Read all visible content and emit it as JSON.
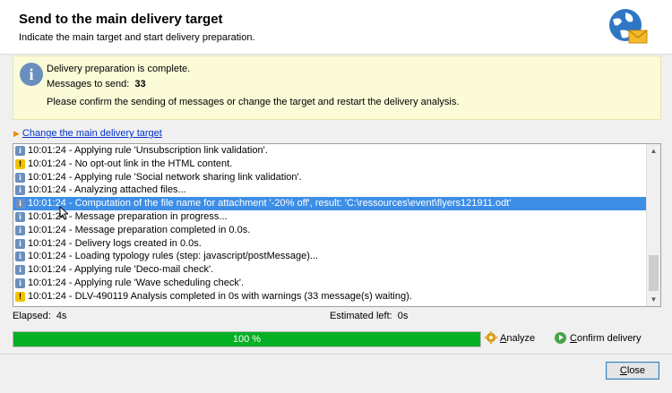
{
  "header": {
    "title": "Send to the main delivery target",
    "subtitle": "Indicate the main target and start delivery preparation."
  },
  "info": {
    "line1": "Delivery preparation is complete.",
    "messages_label": "Messages to send:",
    "messages_count": "33",
    "line3": "Please confirm the sending of messages or change the target and restart the delivery analysis."
  },
  "change_target_link": "Change the main delivery target",
  "log": [
    {
      "type": "info",
      "text": "10:01:24 - Applying rule 'Unsubscription link validation'."
    },
    {
      "type": "warn",
      "text": "10:01:24 - No opt-out link in the HTML content."
    },
    {
      "type": "info",
      "text": "10:01:24 - Applying rule 'Social network sharing link validation'."
    },
    {
      "type": "info",
      "text": "10:01:24 - Analyzing attached files..."
    },
    {
      "type": "info",
      "text": "10:01:24 - Computation of the file name for attachment '-20% off', result: 'C:\\ressources\\event\\flyers121911.odt'",
      "selected": true
    },
    {
      "type": "info",
      "text": "10:01:24 - Message preparation in progress..."
    },
    {
      "type": "info",
      "text": "10:01:24 - Message preparation completed in 0.0s."
    },
    {
      "type": "info",
      "text": "10:01:24 - Delivery logs created in 0.0s."
    },
    {
      "type": "info",
      "text": "10:01:24 - Loading typology rules (step: javascript/postMessage)..."
    },
    {
      "type": "info",
      "text": "10:01:24 - Applying rule 'Deco-mail check'."
    },
    {
      "type": "info",
      "text": "10:01:24 - Applying rule 'Wave scheduling check'."
    },
    {
      "type": "warn",
      "text": "10:01:24 - DLV-490119 Analysis completed in 0s with warnings (33 message(s) waiting)."
    }
  ],
  "status": {
    "elapsed_label": "Elapsed:",
    "elapsed_value": "4s",
    "estimated_label": "Estimated left:",
    "estimated_value": "0s",
    "progress_text": "100 %",
    "progress_fraction": 1.0
  },
  "buttons": {
    "analyze": "Analyze",
    "confirm": "Confirm delivery",
    "close": "Close"
  },
  "colors": {
    "progress": "#06b025",
    "selection": "#3d8ee6",
    "info_panel": "#fbfbd8"
  }
}
